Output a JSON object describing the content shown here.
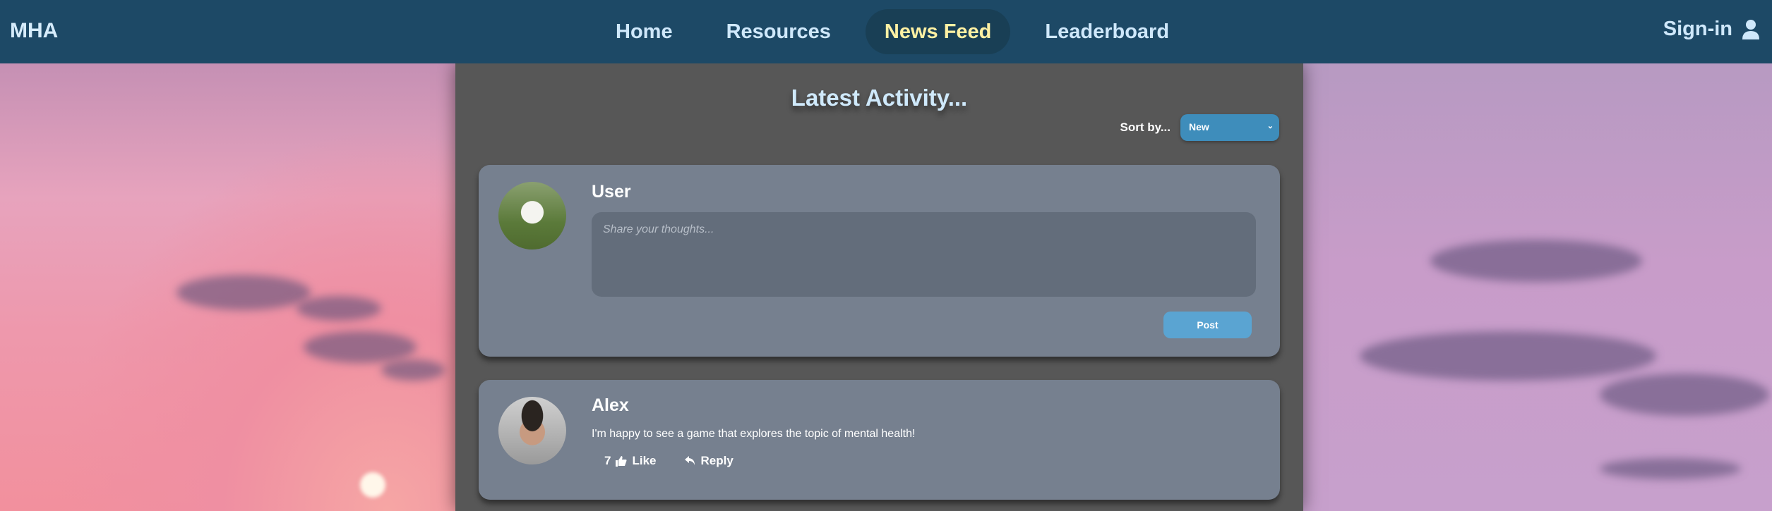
{
  "nav": {
    "logo": "MHA",
    "links": [
      "Home",
      "Resources",
      "News Feed",
      "Leaderboard"
    ],
    "active": "News Feed",
    "signin": "Sign-in"
  },
  "feed": {
    "title": "Latest Activity...",
    "sort_label": "Sort by...",
    "sort_value": "New"
  },
  "composer": {
    "user": "User",
    "placeholder": "Share your thoughts...",
    "post_label": "Post"
  },
  "posts": [
    {
      "author": "Alex",
      "text": "I'm happy to see a game that explores the topic of mental health!",
      "likes": "7",
      "like_label": "Like",
      "reply_label": "Reply"
    }
  ],
  "colors": {
    "nav": "#1d4966",
    "active_link": "#fff1a3",
    "panel": "#575757",
    "card": "#76808f",
    "button": "#5aa4d2"
  }
}
